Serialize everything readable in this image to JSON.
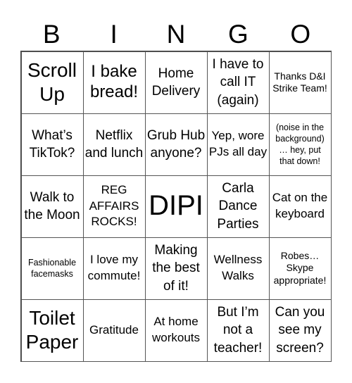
{
  "header": {
    "letters": [
      "B",
      "I",
      "N",
      "G",
      "O"
    ]
  },
  "board": {
    "cells": [
      [
        "Scroll Up",
        "I bake bread!",
        "Home Delivery",
        "I have to call IT (again)",
        "Thanks D&I Strike Team!"
      ],
      [
        "What’s TikTok?",
        "Netflix and lunch",
        "Grub Hub anyone?",
        "Yep, wore PJs all day",
        "(noise in the background) … hey, put that down!"
      ],
      [
        "Walk to the Moon",
        "REG AFFAIRS ROCKS!",
        "DIPI",
        "Carla Dance Parties",
        "Cat on the keyboard"
      ],
      [
        "Fashionable facemasks",
        "I love my commute!",
        "Making the best of it!",
        "Wellness Walks",
        "Robes… Skype appropriate!"
      ],
      [
        "Toilet Paper",
        "Gratitude",
        "At home workouts",
        "But I’m not a teacher!",
        "Can you see my screen?"
      ]
    ],
    "free_space": "DIPI"
  }
}
